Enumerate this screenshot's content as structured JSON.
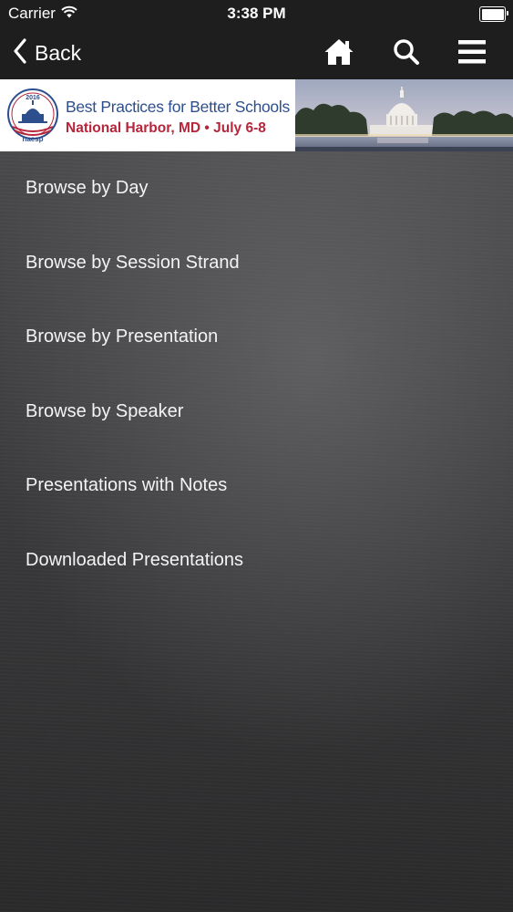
{
  "status_bar": {
    "carrier": "Carrier",
    "time": "3:38 PM",
    "battery_level": 1.0
  },
  "nav": {
    "back_label": "Back",
    "icons": [
      "home-icon",
      "search-icon",
      "hamburger-menu-icon"
    ]
  },
  "banner": {
    "title": "Best Practices for Better Schools",
    "subtitle": "National Harbor, MD • July 6-8",
    "seal_year": "2016",
    "seal_org": "naesp"
  },
  "menu": {
    "items": [
      {
        "label": "Browse by Day"
      },
      {
        "label": "Browse by Session Strand"
      },
      {
        "label": "Browse by Presentation"
      },
      {
        "label": "Browse by Speaker"
      },
      {
        "label": "Presentations with Notes"
      },
      {
        "label": "Downloaded Presentations"
      }
    ]
  },
  "colors": {
    "bar_background": "#1e1e1e",
    "banner_blue": "#2d4f8e",
    "banner_red": "#b7253a",
    "menu_text": "#f4f4f4"
  }
}
